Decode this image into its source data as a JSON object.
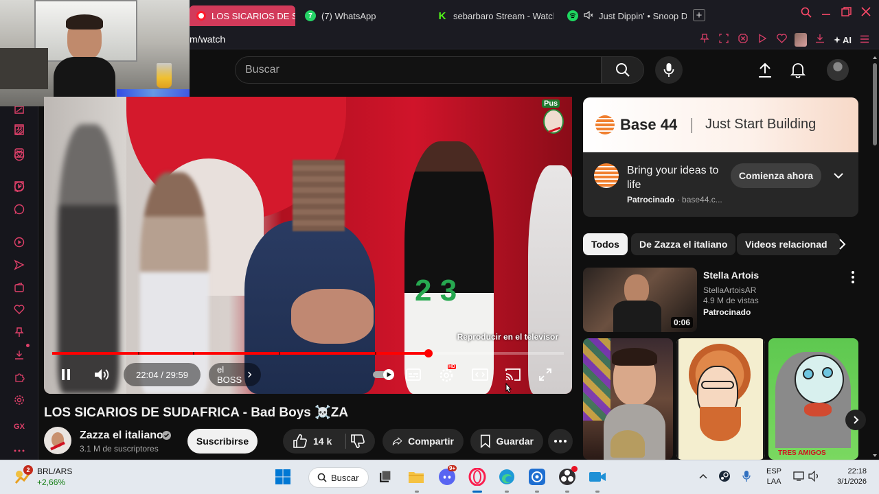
{
  "browser": {
    "tabs": [
      {
        "label": "LOS SICARIOS DE SUD",
        "icon": "opera-icon",
        "active": true
      },
      {
        "label": "(7) WhatsApp",
        "icon": "whatsapp-icon",
        "active": false
      },
      {
        "label": "sebarbaro Stream - Watch",
        "icon": "kick-icon",
        "active": false
      },
      {
        "label": "Just Dippin' • Snoop D",
        "icon": "spotify-icon",
        "active": false
      }
    ],
    "whatsapp_badge": "7",
    "kick_letter": "K",
    "url_path": "m/watch",
    "ai_label": "AI"
  },
  "youtube": {
    "search_placeholder": "Buscar",
    "player": {
      "cast_tooltip": "Reproducir en el televisor",
      "current_time": "22:04",
      "duration": "29:59",
      "time_display": "22:04 / 29:59",
      "chapter": "el BOSS",
      "progress_fraction": 0.736,
      "hd_badge": "HD",
      "watermark_text": "Pus"
    },
    "video": {
      "title": "LOS SICARIOS DE SUDAFRICA - Bad Boys ☠️ZA",
      "channel_name": "Zazza el italiano",
      "subscribers": "3.1 M de suscriptores",
      "subscribe_label": "Suscribirse",
      "likes": "14 k",
      "share_label": "Compartir",
      "save_label": "Guardar"
    },
    "ad": {
      "brand": "Base 44",
      "tagline": "Just Start Building",
      "headline": "Bring your ideas to life",
      "sponsored_label": "Patrocinado",
      "domain": "base44.c...",
      "cta": "Comienza ahora"
    },
    "chips": [
      "Todos",
      "De Zazza el italiano",
      "Videos relacionad"
    ],
    "recommendation": {
      "title": "Stella Artois",
      "channel": "StellaArtoisAR",
      "views": "4.9 M de vistas",
      "badge": "Patrocinado",
      "duration": "0:06"
    },
    "shorts_caption": "TRES AMIGOS"
  },
  "taskbar": {
    "weather_badge": "2",
    "ticker": "BRL/ARS",
    "ticker_change": "+2,66%",
    "search_label": "Buscar",
    "discord_badge": "9+",
    "lang_line1": "ESP",
    "lang_line2": "LAA",
    "time": "22:18",
    "date": "3/1/2026"
  },
  "sidebar": {
    "gx_label": "GX"
  },
  "colors": {
    "opera_accent": "#e0406a",
    "active_tab": "#d23a5a",
    "progress_red": "#ff0000",
    "yt_bg": "#0f0f0f",
    "ad_orange": "#f08030"
  }
}
